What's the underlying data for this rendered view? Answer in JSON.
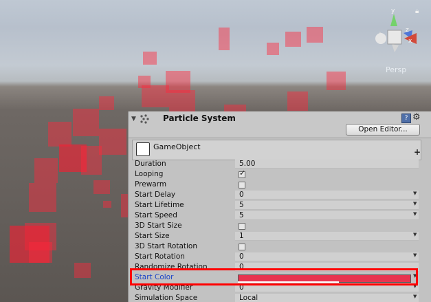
{
  "scene": {
    "view_mode": "Persp",
    "gizmo_axes": {
      "y": "y",
      "z": "z",
      "x": "x"
    },
    "particle_color": "#f01e32"
  },
  "inspector": {
    "component_title": "Particle System",
    "open_editor_label": "Open Editor...",
    "module_name": "GameObject",
    "highlight_color": "#ff0000",
    "properties": [
      {
        "label": "Duration",
        "type": "text",
        "value": "5.00"
      },
      {
        "label": "Looping",
        "type": "checkbox",
        "checked": true
      },
      {
        "label": "Prewarm",
        "type": "checkbox",
        "checked": false
      },
      {
        "label": "Start Delay",
        "type": "dropdown",
        "value": "0"
      },
      {
        "label": "Start Lifetime",
        "type": "dropdown",
        "value": "5"
      },
      {
        "label": "Start Speed",
        "type": "dropdown",
        "value": "5"
      },
      {
        "label": "3D Start Size",
        "type": "checkbox",
        "checked": false
      },
      {
        "label": "Start Size",
        "type": "dropdown",
        "value": "1"
      },
      {
        "label": "3D Start Rotation",
        "type": "checkbox",
        "checked": false
      },
      {
        "label": "Start Rotation",
        "type": "dropdown",
        "value": "0"
      },
      {
        "label": "Randomize Rotation",
        "type": "text",
        "value": "0"
      },
      {
        "label": "Start Color",
        "type": "color",
        "value": "#e8344f",
        "highlighted": true
      },
      {
        "label": "Gravity Modifier",
        "type": "dropdown",
        "value": "0"
      },
      {
        "label": "Simulation Space",
        "type": "dropdown",
        "value": "Local"
      }
    ]
  }
}
